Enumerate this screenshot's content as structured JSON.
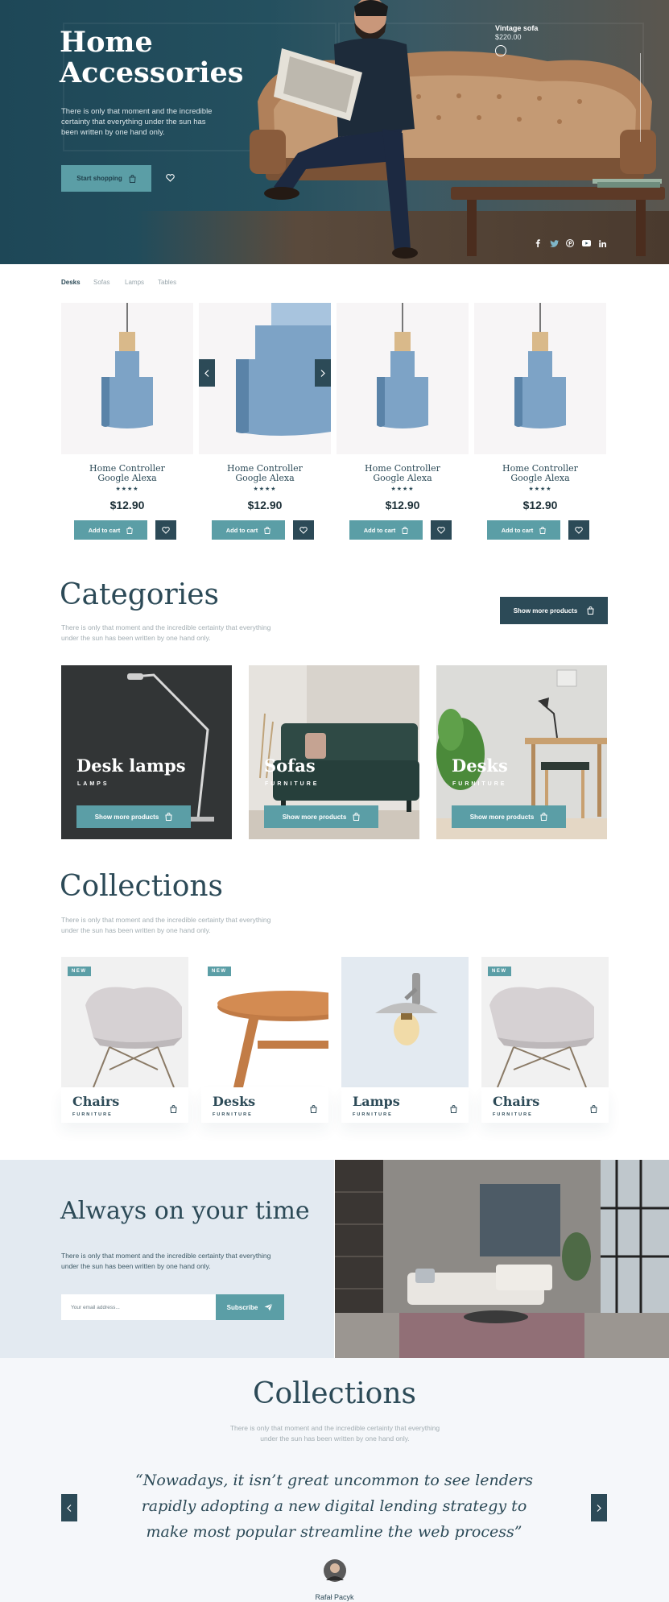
{
  "hero": {
    "title_line1": "Home",
    "title_line2": "Accessories",
    "text": "There is only that moment and the incredible certainty that everything under the sun has been written by one hand only.",
    "cta_label": "Start shopping",
    "spot_label": "Vintage sofa",
    "spot_price": "$220.00"
  },
  "tabs": [
    "Desks",
    "Sofas",
    "Lamps",
    "Tables"
  ],
  "products": [
    {
      "name1": "Home Controller",
      "name2": "Google Alexa",
      "stars": "★★★★",
      "price": "$12.90",
      "cart": "Add to cart"
    },
    {
      "name1": "Home Controller",
      "name2": "Google Alexa",
      "stars": "★★★★",
      "price": "$12.90",
      "cart": "Add to cart"
    },
    {
      "name1": "Home Controller",
      "name2": "Google Alexa",
      "stars": "★★★★",
      "price": "$12.90",
      "cart": "Add to cart"
    },
    {
      "name1": "Home Controller",
      "name2": "Google Alexa",
      "stars": "★★★★",
      "price": "$12.90",
      "cart": "Add to cart"
    }
  ],
  "categories": {
    "title": "Categories",
    "text": "There is only that moment and the incredible certainty that everything under the sun has been written by one hand only.",
    "more_label": "Show more products",
    "items": [
      {
        "title": "Desk lamps",
        "sub": "LAMPS",
        "btn": "Show more products"
      },
      {
        "title": "Sofas",
        "sub": "FURNITURE",
        "btn": "Show more products"
      },
      {
        "title": "Desks",
        "sub": "FURNITURE",
        "btn": "Show more products"
      }
    ]
  },
  "collections": {
    "title": "Collections",
    "text": "There is only that moment and the incredible certainty that everything under the sun has been written by one hand only.",
    "items": [
      {
        "title": "Chairs",
        "sub": "FURNITURE",
        "badge": "NEW"
      },
      {
        "title": "Desks",
        "sub": "FURNITURE",
        "badge": "NEW"
      },
      {
        "title": "Lamps",
        "sub": "FURNITURE",
        "badge": ""
      },
      {
        "title": "Chairs",
        "sub": "FURNITURE",
        "badge": "NEW"
      }
    ]
  },
  "newsletter": {
    "title": "Always on your time",
    "text": "There is only that moment and the incredible certainty that everything under the sun has been written by one hand only.",
    "placeholder": "Your email address...",
    "button": "Subscribe"
  },
  "testimonial": {
    "title": "Collections",
    "text": "There is only that moment and the incredible certainty that everything under the sun has been written by one hand only.",
    "quote": "“Nowadays, it isn’t great uncommon to see lenders rapidly adopting a new digital lending strategy to make most  popular streamline the web process”",
    "author": "Rafał Pacyk"
  },
  "colors": {
    "primary": "#2c4a57",
    "accent": "#5b9ea6",
    "light_blue": "#e3eaf1"
  }
}
